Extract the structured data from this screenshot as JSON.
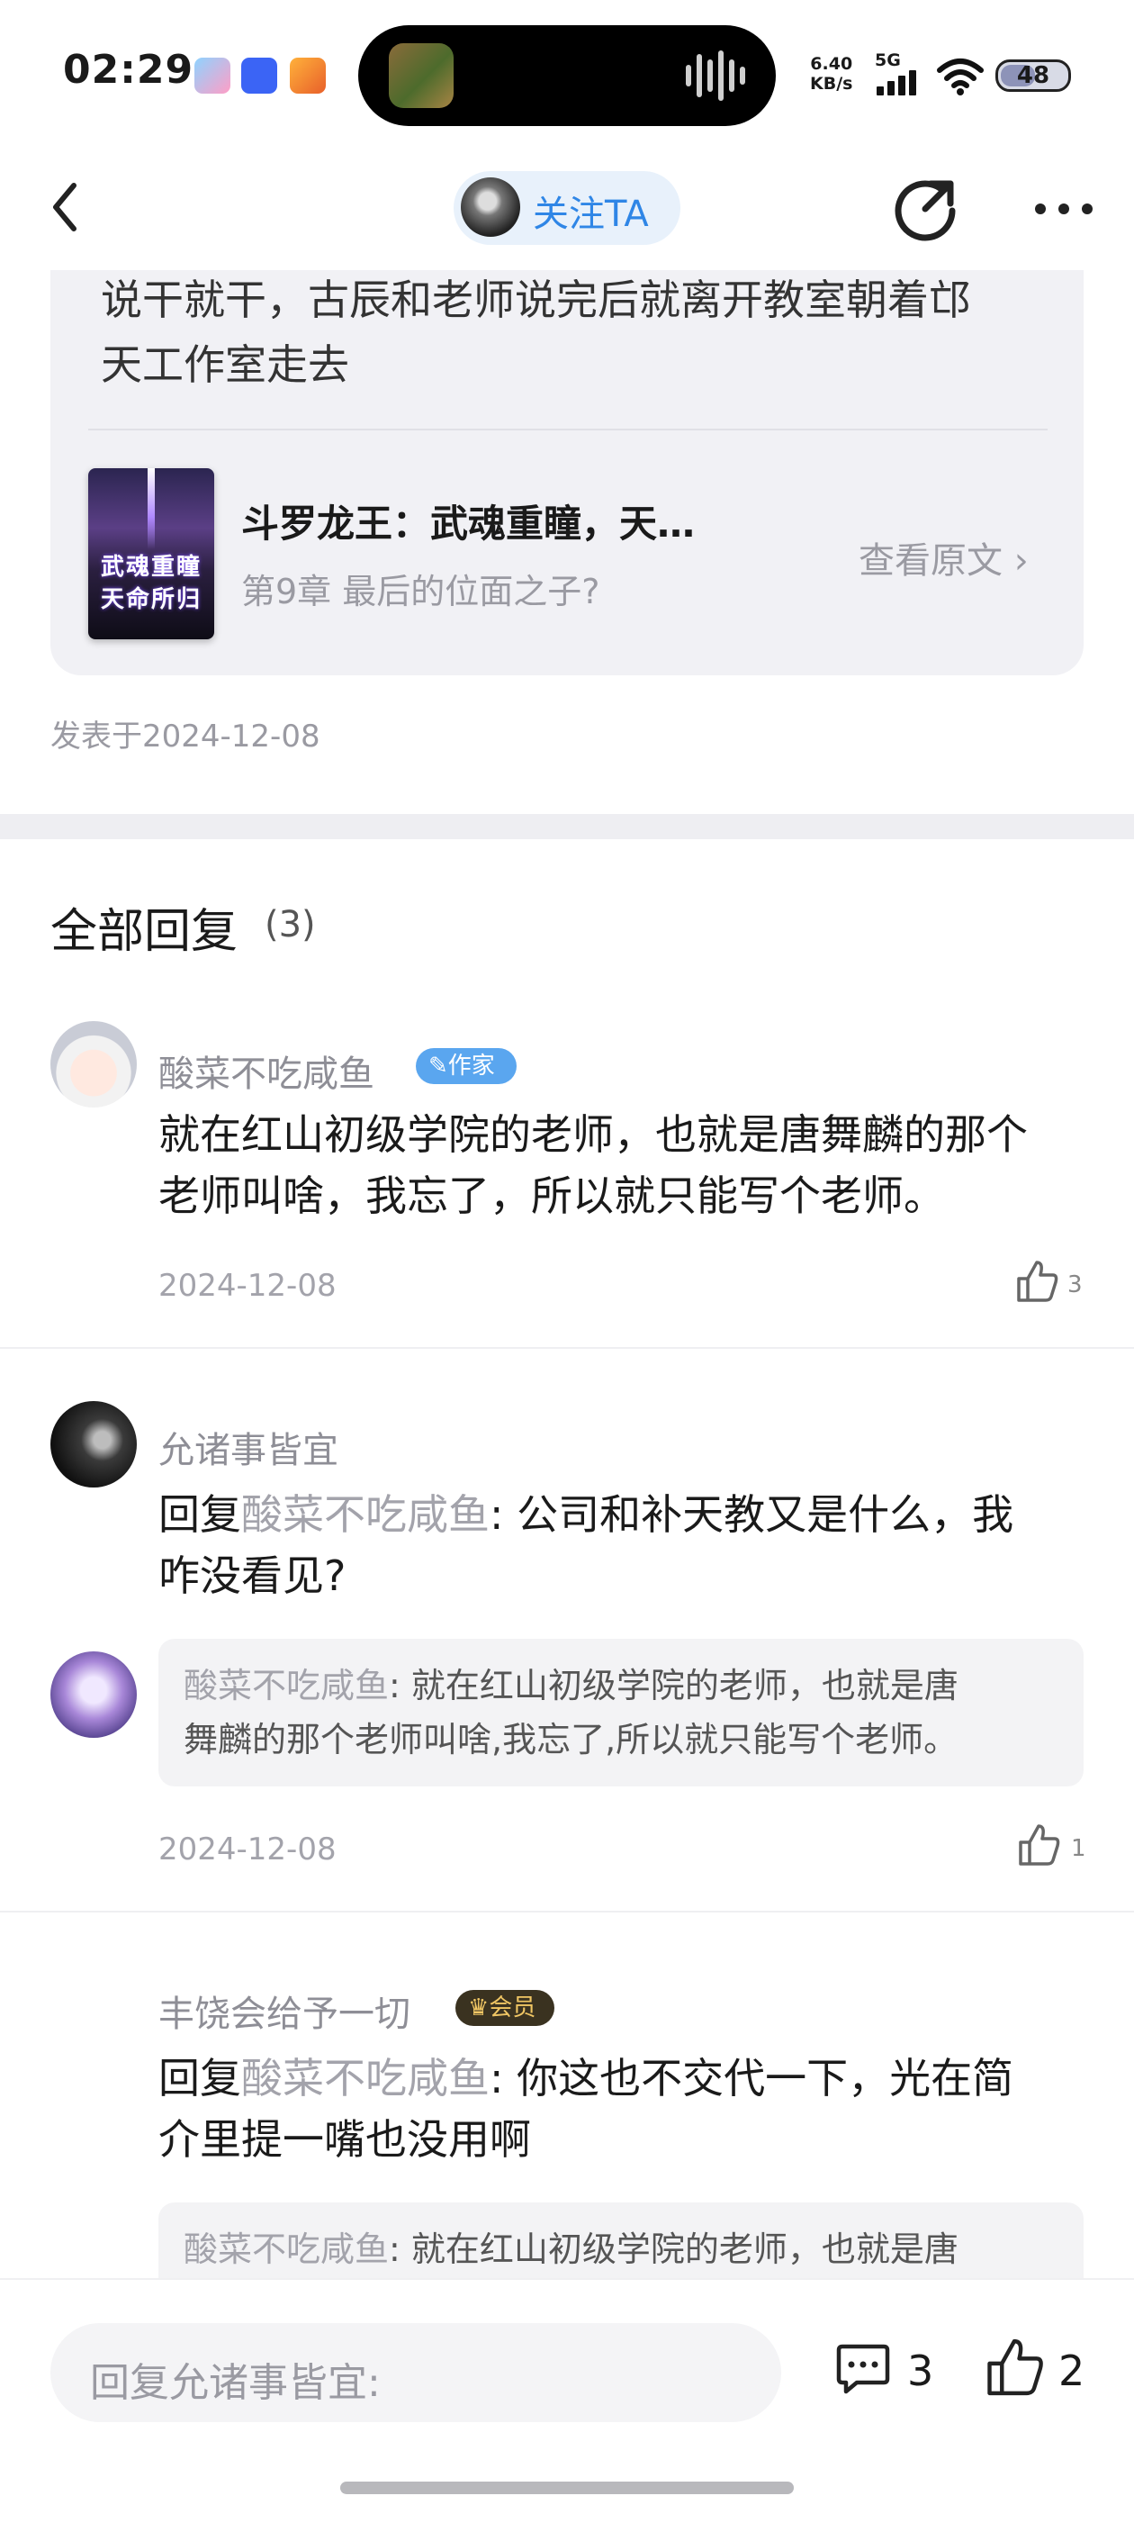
{
  "status_bar": {
    "time": "02:29",
    "network_speed_value": "6.40",
    "network_speed_unit": "KB/s",
    "network_type": "5G",
    "battery": "48"
  },
  "header": {
    "follow_label": "关注TA"
  },
  "quoted_post": {
    "text_line1": "说干就干，古辰和老师说完后就离开教室朝着邙",
    "text_line2": "天工作室走去",
    "book": {
      "cover_line1": "武魂重瞳",
      "cover_line2": "天命所归",
      "title": "斗罗龙王：武魂重瞳，天…",
      "chapter": "第9章 最后的位面之子?",
      "view_original": "查看原文 ›"
    },
    "posted_at": "发表于2024-12-08"
  },
  "replies": {
    "title": "全部回复",
    "count": "(3)",
    "items": [
      {
        "username": "酸菜不吃咸鱼",
        "badge": "作家",
        "text_line1": "就在红山初级学院的老师，也就是唐舞麟的那个",
        "text_line2": "老师叫啥，我忘了，所以就只能写个老师。",
        "date": "2024-12-08",
        "likes": "3"
      },
      {
        "username": "允诸事皆宜",
        "reply_prefix": "回复",
        "mention": "酸菜不吃咸鱼",
        "text_line1": ": 公司和补天教又是什么，我",
        "text_line2": "咋没看见?",
        "quote_user": "酸菜不吃咸鱼",
        "quote_line1": ": 就在红山初级学院的老师，也就是唐",
        "quote_line2": "舞麟的那个老师叫啥,我忘了,所以就只能写个老师。",
        "date": "2024-12-08",
        "likes": "1"
      },
      {
        "username": "丰饶会给予一切",
        "badge": "会员",
        "reply_prefix": "回复",
        "mention": "酸菜不吃咸鱼",
        "text_line1": ": 你这也不交代一下，光在简",
        "text_line2": "介里提一嘴也没用啊",
        "quote_user": "酸菜不吃咸鱼",
        "quote_line1": ": 就在红山初级学院的老师，也就是唐"
      }
    ]
  },
  "bottom_bar": {
    "reply_placeholder": "回复允诸事皆宜:",
    "comment_count": "3",
    "like_count": "2"
  },
  "icons": [
    "back-icon",
    "share-icon",
    "more-icon",
    "chevron-right-icon",
    "thumbs-up-icon",
    "comment-icon",
    "wifi-icon",
    "signal-icon",
    "battery-icon",
    "pen-icon",
    "crown-icon",
    "soundwave-icon"
  ],
  "colors": {
    "accent": "#2f86e6",
    "author_badge": "#5aa6ef",
    "member_badge": "#3a3220",
    "member_badge_text": "#f0c664",
    "muted_text": "#9a9aa2"
  }
}
